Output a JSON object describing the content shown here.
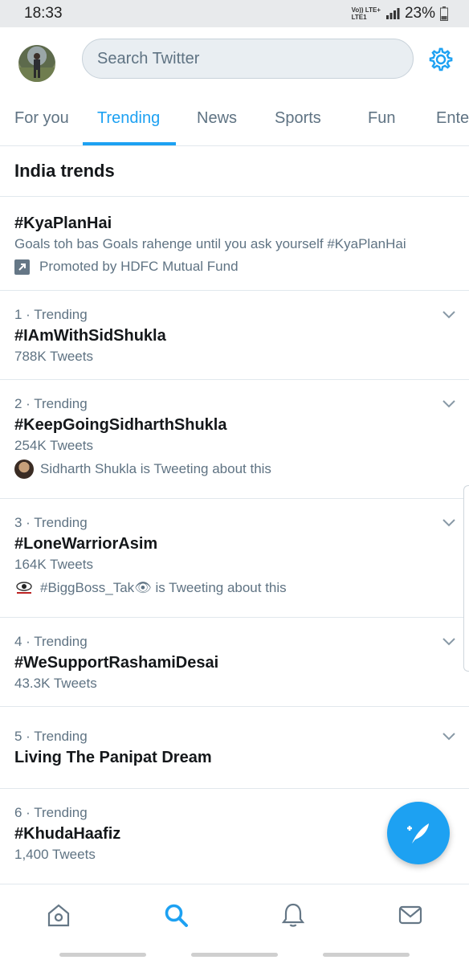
{
  "status_bar": {
    "time": "18:33",
    "network_top": "Vo)) LTE+",
    "network_bottom": "LTE1",
    "battery": "23%"
  },
  "header": {
    "search_placeholder": "Search Twitter",
    "settings_icon": "gear-icon"
  },
  "tabs": [
    {
      "label": "For you"
    },
    {
      "label": "Trending"
    },
    {
      "label": "News"
    },
    {
      "label": "Sports"
    },
    {
      "label": "Fun"
    },
    {
      "label": "Ente"
    }
  ],
  "active_tab": "Trending",
  "section_title": "India trends",
  "promoted": {
    "tag": "#KyaPlanHai",
    "description": "Goals toh bas Goals rahenge until you ask yourself #KyaPlanHai",
    "promoted_by": "Promoted by HDFC Mutual Fund"
  },
  "trends": [
    {
      "rank": "1 · Trending",
      "name": "#IAmWithSidShukla",
      "count": "788K Tweets",
      "context": ""
    },
    {
      "rank": "2 · Trending",
      "name": "#KeepGoingSidharthShukla",
      "count": "254K Tweets",
      "context": "Sidharth Shukla is Tweeting about this"
    },
    {
      "rank": "3 · Trending",
      "name": "#LoneWarriorAsim",
      "count": "164K Tweets",
      "context": "#BiggBoss_Tak👁 is Tweeting about this"
    },
    {
      "rank": "4 · Trending",
      "name": "#WeSupportRashamiDesai",
      "count": "43.3K Tweets",
      "context": ""
    },
    {
      "rank": "5 · Trending",
      "name": "Living The Panipat Dream",
      "count": "",
      "context": ""
    },
    {
      "rank": "6 · Trending",
      "name": "#KhudaHaafiz",
      "count": "1,400 Tweets",
      "context": ""
    }
  ],
  "colors": {
    "accent": "#1da1f2",
    "secondary_text": "#5f7383",
    "primary_text": "#14171a",
    "divider": "#e1e8ed"
  },
  "bottom_nav": [
    "home-icon",
    "search-icon",
    "notifications-icon",
    "messages-icon"
  ]
}
